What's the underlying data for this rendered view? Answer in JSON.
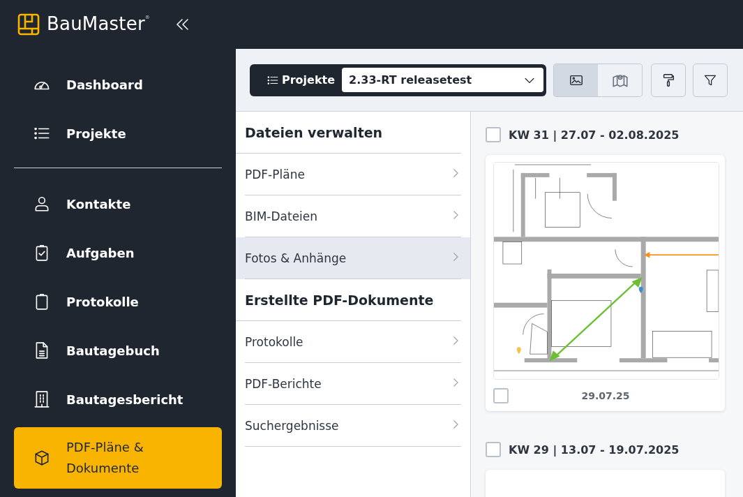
{
  "app": {
    "name": "BauMaster",
    "mark": "®"
  },
  "sidebar": {
    "groups": [
      {
        "items": [
          {
            "label": "Dashboard",
            "kind": "gauge",
            "selected": false
          },
          {
            "label": "Projekte",
            "kind": "list",
            "selected": false
          }
        ]
      },
      {
        "items": [
          {
            "label": "Kontakte",
            "kind": "person",
            "selected": false
          },
          {
            "label": "Aufgaben",
            "kind": "clipboard-check",
            "selected": false
          },
          {
            "label": "Protokolle",
            "kind": "clipboard",
            "selected": false
          },
          {
            "label": "Bautagebuch",
            "kind": "document",
            "selected": false
          },
          {
            "label": "Bautagesbericht",
            "kind": "building",
            "selected": false
          },
          {
            "label": "PDF-Pläne & Dokumente",
            "kind": "cube",
            "selected": true
          }
        ]
      }
    ]
  },
  "toolbar": {
    "project_label": "Projekte",
    "project_select": {
      "value": "2.33-RT releasetest"
    },
    "view_toggle": [
      {
        "kind": "image",
        "selected": true
      },
      {
        "kind": "map",
        "selected": false
      }
    ],
    "tools": [
      {
        "kind": "paint-roller"
      },
      {
        "kind": "filter"
      }
    ]
  },
  "file_menu": {
    "sections": [
      {
        "heading": "Dateien verwalten",
        "items": [
          {
            "label": "PDF-Pläne",
            "selected": false
          },
          {
            "label": "BIM-Dateien",
            "selected": false
          },
          {
            "label": "Fotos & Anhänge",
            "selected": true
          }
        ]
      },
      {
        "heading": "Erstellte PDF-Dokumente",
        "items": [
          {
            "label": "Protokolle",
            "selected": false
          },
          {
            "label": "PDF-Berichte",
            "selected": false
          },
          {
            "label": "Suchergebnisse",
            "selected": false
          }
        ]
      }
    ]
  },
  "gallery": {
    "weeks": [
      {
        "label": "KW 31 | 27.07 - 02.08.2025",
        "checked": false,
        "items": [
          {
            "kind": "plan",
            "date": "29.07.25",
            "checked": false
          }
        ]
      },
      {
        "label": "KW 29 | 13.07 - 19.07.2025",
        "checked": false,
        "items": [
          {
            "kind": "loading"
          }
        ]
      }
    ]
  }
}
